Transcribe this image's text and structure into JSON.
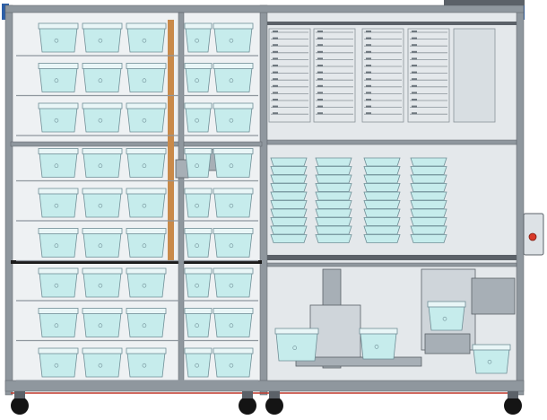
{
  "colors": {
    "background": "#ffffff",
    "frame": "#8f979e",
    "frame_dark": "#5b6168",
    "panel_left": "#eef1f3",
    "panel_right": "#e4e8eb",
    "cage_fill": "#c6ecec",
    "cage_stroke": "#6f8e96",
    "cage_lid": "#e9f6f7",
    "tray_fill": "#dde2e6",
    "tray_stroke": "#8a939a",
    "orange_rail": "#c98a4a",
    "blue_cap": "#2c5fa8",
    "wheel": "#141414",
    "indicator_red": "#d83a2a",
    "red_line": "#c0392b",
    "rack_bar": "#1b1b1b"
  },
  "icons": {
    "cabinet": "robot-cabinet-icon",
    "cage": "cage-icon",
    "wheel": "caster-wheel-icon",
    "control_box": "control-box-icon"
  },
  "structure": {
    "left_rack_rows": 9,
    "left_rack_cols": 5,
    "drawer_columns": 4,
    "drawers_per_column": 13,
    "stacked_cage_columns": 4,
    "cages_per_stack": 10,
    "wheels": 4
  }
}
